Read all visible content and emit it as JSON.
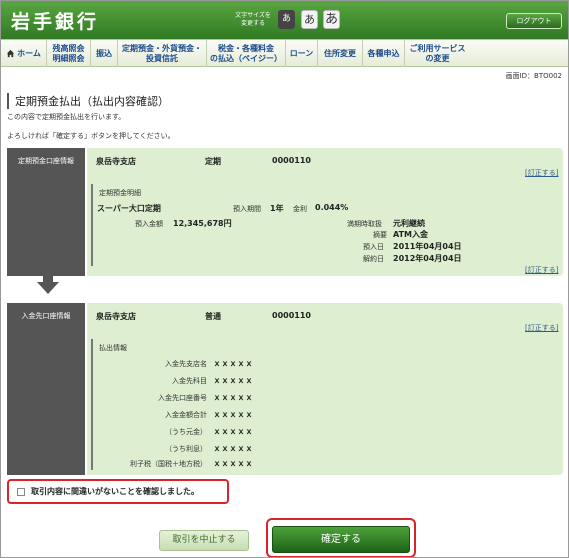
{
  "header": {
    "logo": "岩手銀行",
    "font_size_label": "文字サイズを\n変更する",
    "font_sizes": [
      "あ",
      "あ",
      "あ"
    ],
    "logout": "ログアウト",
    "brand_color": "#3d8b2e"
  },
  "nav": {
    "items": [
      {
        "label": "ホーム",
        "icon": "home-icon"
      },
      {
        "label": "残高照会\n明細照会"
      },
      {
        "label": "振込"
      },
      {
        "label": "定期預金・外貨預金・\n投資信託"
      },
      {
        "label": "税金・各種料金\nの払込（ペイジー）"
      },
      {
        "label": "ローン"
      },
      {
        "label": "住所変更"
      },
      {
        "label": "各種申込"
      },
      {
        "label": "ご利用サービス\nの変更"
      }
    ]
  },
  "screen_id": "画面ID：BTO002",
  "page": {
    "title": "定期預金払出（払出内容確認）",
    "intro1": "この内容で定期預金払出を行います。",
    "intro2": "よろしければ「確定する」ボタンを押してください。"
  },
  "account": {
    "label": "定期預金口座情報",
    "branch": "泉岳寺支店",
    "type": "定期",
    "number": "0000110",
    "edit": "[訂正する]",
    "detail_title": "定期預金明細",
    "product": "スーパー大口定期",
    "term_label": "預入期間",
    "term": "1年",
    "rate_label": "金利",
    "rate": "0.044%",
    "amount_label": "預入金額",
    "amount": "12,345,678円",
    "maturity_label": "満期時取扱",
    "maturity": "元利継続",
    "summary_label": "摘要",
    "summary": "ATM入金",
    "deposit_date_label": "預入日",
    "deposit_date": "2011年04月04日",
    "cancel_date_label": "解約日",
    "cancel_date": "2012年04月04日",
    "edit2": "[訂正する]"
  },
  "destination": {
    "label": "入金先口座情報",
    "branch": "泉岳寺支店",
    "type": "普通",
    "number": "0000110",
    "edit": "[訂正する]",
    "detail_title": "払出情報",
    "rows": [
      {
        "label": "入金先支店名",
        "value": "ｘｘｘｘｘ"
      },
      {
        "label": "入金先科目",
        "value": "ｘｘｘｘｘ"
      },
      {
        "label": "入金先口座番号",
        "value": "ｘｘｘｘｘ"
      },
      {
        "label": "入金金額合計",
        "value": "ｘｘｘｘｘ"
      },
      {
        "label": "（うち元金）",
        "value": "ｘｘｘｘｘ"
      },
      {
        "label": "（うち利息）",
        "value": "ｘｘｘｘｘ"
      },
      {
        "label": "利子税（国税＋地方税）",
        "value": "ｘｘｘｘｘ"
      }
    ]
  },
  "confirm": {
    "label": "取引内容に間違いがないことを確認しました。",
    "checked": false
  },
  "buttons": {
    "cancel": "取引を中止する",
    "submit": "確定する"
  }
}
